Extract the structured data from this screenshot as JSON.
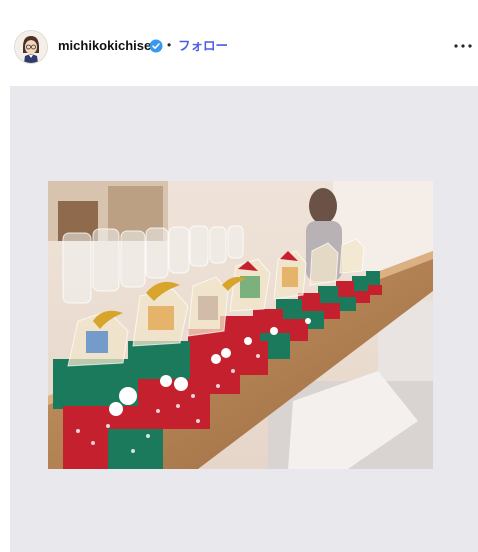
{
  "post": {
    "username": "michikokichise",
    "verified": true,
    "separator": "•",
    "follow_label": "フォロー"
  },
  "icons": {
    "avatar": "profile-avatar",
    "verified": "verified-badge-icon",
    "more": "more-options-icon"
  },
  "colors": {
    "follow": "#4a5de8",
    "verified": "#3897f0",
    "media_background": "#e9e9ed"
  }
}
